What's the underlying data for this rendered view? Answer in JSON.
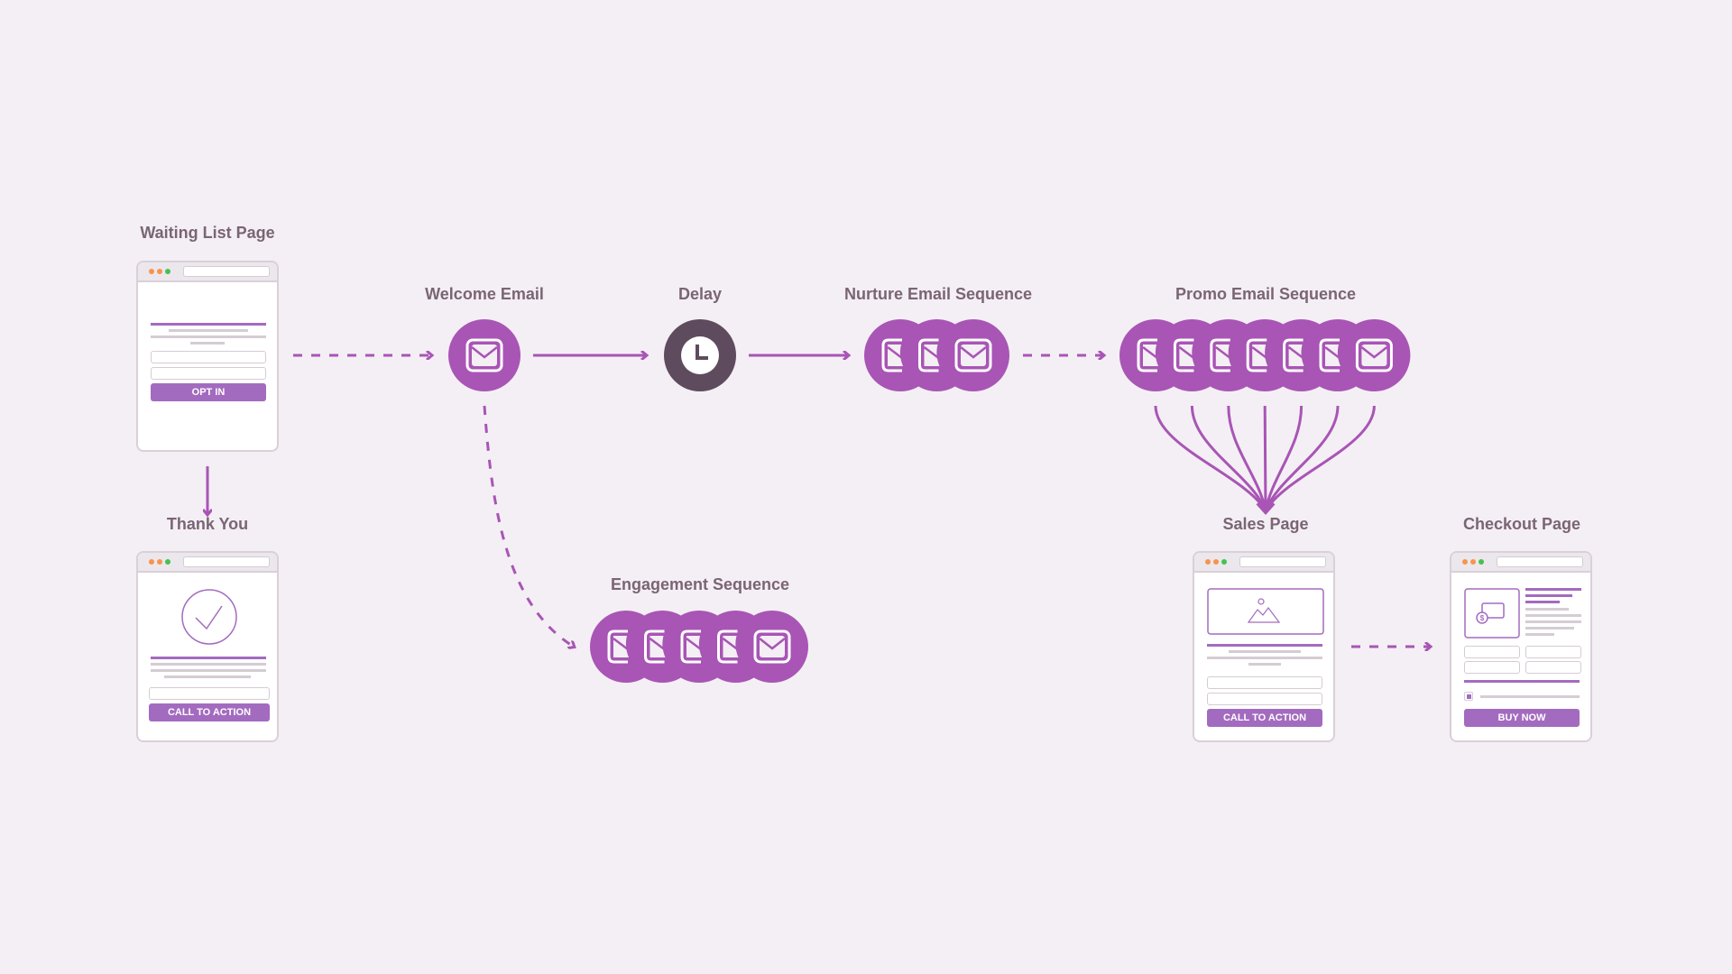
{
  "colors": {
    "background": "#f4eff4",
    "accent": "#a855b5",
    "delay": "#5e4b5e",
    "label": "#7a6574",
    "button": "#a36bbf"
  },
  "nodes": {
    "waiting_list": {
      "title": "Waiting List Page",
      "button": "OPT IN"
    },
    "thank_you": {
      "title": "Thank You",
      "button": "CALL TO ACTION"
    },
    "welcome_email": {
      "title": "Welcome Email",
      "icon": "envelope-icon",
      "count": 1
    },
    "delay": {
      "title": "Delay",
      "icon": "clock-icon"
    },
    "nurture": {
      "title": "Nurture Email Sequence",
      "icon": "envelope-icon",
      "count": 3
    },
    "promo": {
      "title": "Promo Email Sequence",
      "icon": "envelope-icon",
      "count": 7
    },
    "engagement": {
      "title": "Engagement Sequence",
      "icon": "envelope-icon",
      "count": 5
    },
    "sales_page": {
      "title": "Sales Page",
      "button": "CALL TO ACTION"
    },
    "checkout_page": {
      "title": "Checkout Page",
      "button": "BUY NOW"
    }
  },
  "edges": [
    {
      "from": "waiting_list",
      "to": "welcome_email",
      "style": "dashed"
    },
    {
      "from": "waiting_list",
      "to": "thank_you",
      "style": "solid"
    },
    {
      "from": "welcome_email",
      "to": "delay",
      "style": "solid"
    },
    {
      "from": "delay",
      "to": "nurture",
      "style": "solid"
    },
    {
      "from": "nurture",
      "to": "promo",
      "style": "dashed"
    },
    {
      "from": "welcome_email",
      "to": "engagement",
      "style": "dashed"
    },
    {
      "from": "promo",
      "to": "sales_page",
      "style": "solid"
    },
    {
      "from": "sales_page",
      "to": "checkout_page",
      "style": "dashed"
    }
  ]
}
